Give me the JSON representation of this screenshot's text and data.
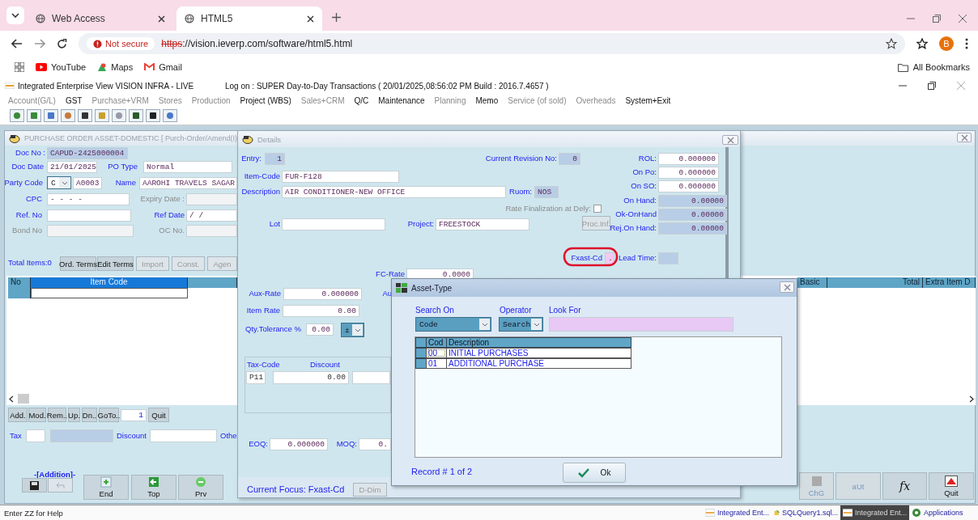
{
  "browser": {
    "tabs": [
      {
        "title": "Web Access",
        "selected": false
      },
      {
        "title": "HTML5",
        "selected": true
      }
    ],
    "security_label": "Not secure",
    "url_scheme": "https",
    "url_rest": "://vision.ieverp.com/software/html5.html",
    "profile_initial": "B",
    "bookmarks": [
      "YouTube",
      "Maps",
      "Gmail"
    ],
    "all_bookmarks": "All Bookmarks"
  },
  "app": {
    "title": "Integrated Enterprise View  VISION INFRA - LIVE",
    "logon": "Log on : SUPER  Day-to-Day Transactions ( 20/01/2025,08:56:02 PM Build : 2016.7.4657 )",
    "menu": [
      {
        "label": "Account(G/L)",
        "disabled": true
      },
      {
        "label": "GST",
        "disabled": false
      },
      {
        "label": "Purchase+VRM",
        "disabled": true
      },
      {
        "label": "Stores",
        "disabled": true
      },
      {
        "label": "Production",
        "disabled": true
      },
      {
        "label": "Project (WBS)",
        "disabled": false
      },
      {
        "label": "Sales+CRM",
        "disabled": true
      },
      {
        "label": "Q/C",
        "disabled": false
      },
      {
        "label": "Maintenance",
        "disabled": false
      },
      {
        "label": "Planning",
        "disabled": true
      },
      {
        "label": "Memo",
        "disabled": false
      },
      {
        "label": "Service (of sold)",
        "disabled": true
      },
      {
        "label": "Overheads",
        "disabled": true
      },
      {
        "label": "System+Exit",
        "disabled": false
      }
    ]
  },
  "po_window": {
    "title": "PURCHASE ORDER ASSET-DOMESTIC  [  Purch-Order/Amend(I)",
    "fields": [
      {
        "label": "Doc No :",
        "value": "CAPUD-2425000004",
        "kind": "readonly"
      },
      {
        "label": "Doc Date",
        "value": "21/01/2025",
        "kind": "normal"
      },
      {
        "label": "PO Type",
        "value": "Normal",
        "kind": "normal"
      },
      {
        "label": "Name",
        "value": "AAROHI TRAVELS SAGAR",
        "kind": "normal"
      },
      {
        "label": "CPC",
        "value": "-   -   -      -",
        "kind": "normal"
      },
      {
        "label": "Expiry Date :",
        "kind": "disabled"
      },
      {
        "label": "Ref. No",
        "kind": "normal"
      },
      {
        "label": "Ref Date",
        "value": " /  /",
        "kind": "normal"
      },
      {
        "label": "Bond No",
        "kind": "disabled"
      },
      {
        "label": "OC No.",
        "kind": "disabled"
      }
    ],
    "party_code": {
      "label": "Party Code",
      "prefix": "C",
      "value": "A0003"
    },
    "total_items": "Total Items:0",
    "buttons": [
      {
        "label": "Ord. Terms",
        "disabled": false
      },
      {
        "label": "Edit Terms",
        "disabled": false
      },
      {
        "label": "Import",
        "disabled": true
      },
      {
        "label": "Const.",
        "disabled": true
      },
      {
        "label": "Agen",
        "disabled": true
      }
    ],
    "grid_columns": [
      {
        "label": "No",
        "selected": false
      },
      {
        "label": "Item Code",
        "selected": true
      }
    ],
    "grid_columns_right": [
      "Basic",
      "Total",
      "Extra Item D"
    ],
    "nav_buttons": [
      "Add.",
      "Mod.",
      "Rem..",
      "Up.",
      "Dn..",
      "GoTo.."
    ],
    "goto_value": "1",
    "quit_label": "Quit",
    "tax_label": "Tax",
    "discount_label": "Discount",
    "other_label": "Othe",
    "mode": "-[Addition]-",
    "bottom_buttons": [
      {
        "label": "End",
        "kind": "end"
      },
      {
        "label": "Top",
        "kind": "top"
      },
      {
        "label": "Prv",
        "kind": "prev"
      }
    ],
    "right_buttons": [
      {
        "label": "ChG",
        "kind": "change",
        "disabled": true
      },
      {
        "label": "aUt",
        "kind": "plain",
        "disabled": true
      },
      {
        "label": "fx",
        "kind": "formula",
        "disabled": false
      },
      {
        "label": "Quit",
        "kind": "quit",
        "disabled": false
      }
    ]
  },
  "details_window": {
    "title": "Details",
    "fields": [
      {
        "label": "Entry:",
        "value": "1",
        "kind": "readonly"
      },
      {
        "label": "Current Revision No:",
        "value": "0",
        "kind": "readonly"
      },
      {
        "label": "ROL:",
        "value": "0.000000",
        "kind": "normal"
      },
      {
        "label": "On Po:",
        "value": "0.000000",
        "kind": "normal"
      },
      {
        "label": "On SO:",
        "value": "0.000000",
        "kind": "normal"
      },
      {
        "label": "On Hand:",
        "value": "0.00000",
        "kind": "readonly"
      },
      {
        "label": "Ok-OnHand",
        "value": "0.00000",
        "kind": "readonly"
      },
      {
        "label": "Rej.On Hand:",
        "value": "0.00000",
        "kind": "readonly"
      },
      {
        "label": "Item-Code",
        "value": "FUR-F128",
        "kind": "normal"
      },
      {
        "label": "Description",
        "value": "AIR CONDITIONER-NEW OFFICE",
        "kind": "normal"
      },
      {
        "label": "Ruom:",
        "value": "NOS",
        "kind": "readonly"
      },
      {
        "label": "Lot",
        "kind": "normal"
      },
      {
        "label": "Project:",
        "value": "FREESTOCK",
        "kind": "normal"
      },
      {
        "label": "Fxast-Cd",
        "value": ".",
        "kind": "focus"
      },
      {
        "label": "Lead Time:",
        "kind": "readonly"
      },
      {
        "label": "FC-Rate",
        "value": "0.0000",
        "kind": "normal"
      },
      {
        "label": "Aux-Rate",
        "value": "0.000000",
        "kind": "normal"
      },
      {
        "label": "Item Rate",
        "value": "0.00",
        "kind": "normal"
      },
      {
        "label": "Qty.Tolerance %",
        "value": "0.00",
        "kind": "normal"
      },
      {
        "label": "EOQ:",
        "value": "0.000000",
        "kind": "normal"
      },
      {
        "label": "MOQ:",
        "value": "0.",
        "kind": "normal"
      },
      {
        "label": "Au",
        "kind": "normal"
      }
    ],
    "rate_finalization": {
      "label": "Rate Finalization at Dely:",
      "checked": false
    },
    "proc_button": "Proc.Inf.",
    "tolerance_sign": "±",
    "tax_table": {
      "columns": [
        "Tax-Code",
        "Discount"
      ],
      "values": [
        "P11",
        "0.00"
      ]
    },
    "current_focus": "Current Focus: Fxast-Cd",
    "dim_button": "D-Dim"
  },
  "asset_dialog": {
    "title": "Asset-Type",
    "search_on": {
      "label": "Search On",
      "value": "Code"
    },
    "operator": {
      "label": "Operator",
      "value": "Search"
    },
    "look_for": {
      "label": "Look For"
    },
    "columns": [
      "Cod",
      "Description"
    ],
    "rows": [
      {
        "code": "00",
        "description": "INITIAL PURCHASES",
        "selected": true
      },
      {
        "code": "01",
        "description": "ADDITIONAL PURCHASE",
        "selected": false
      }
    ],
    "record": "Record # 1 of 2",
    "ok": "Ok"
  },
  "status": {
    "help": "Enter ZZ for Help",
    "taskbar": [
      {
        "label": "Integrated Ent...",
        "kind": "app",
        "selected": false
      },
      {
        "label": "SQLQuery1.sql...",
        "kind": "sql",
        "selected": false
      },
      {
        "label": "Integrated Ent...",
        "kind": "app",
        "selected": true
      },
      {
        "label": "Applications",
        "kind": "apps",
        "selected": false
      }
    ]
  }
}
